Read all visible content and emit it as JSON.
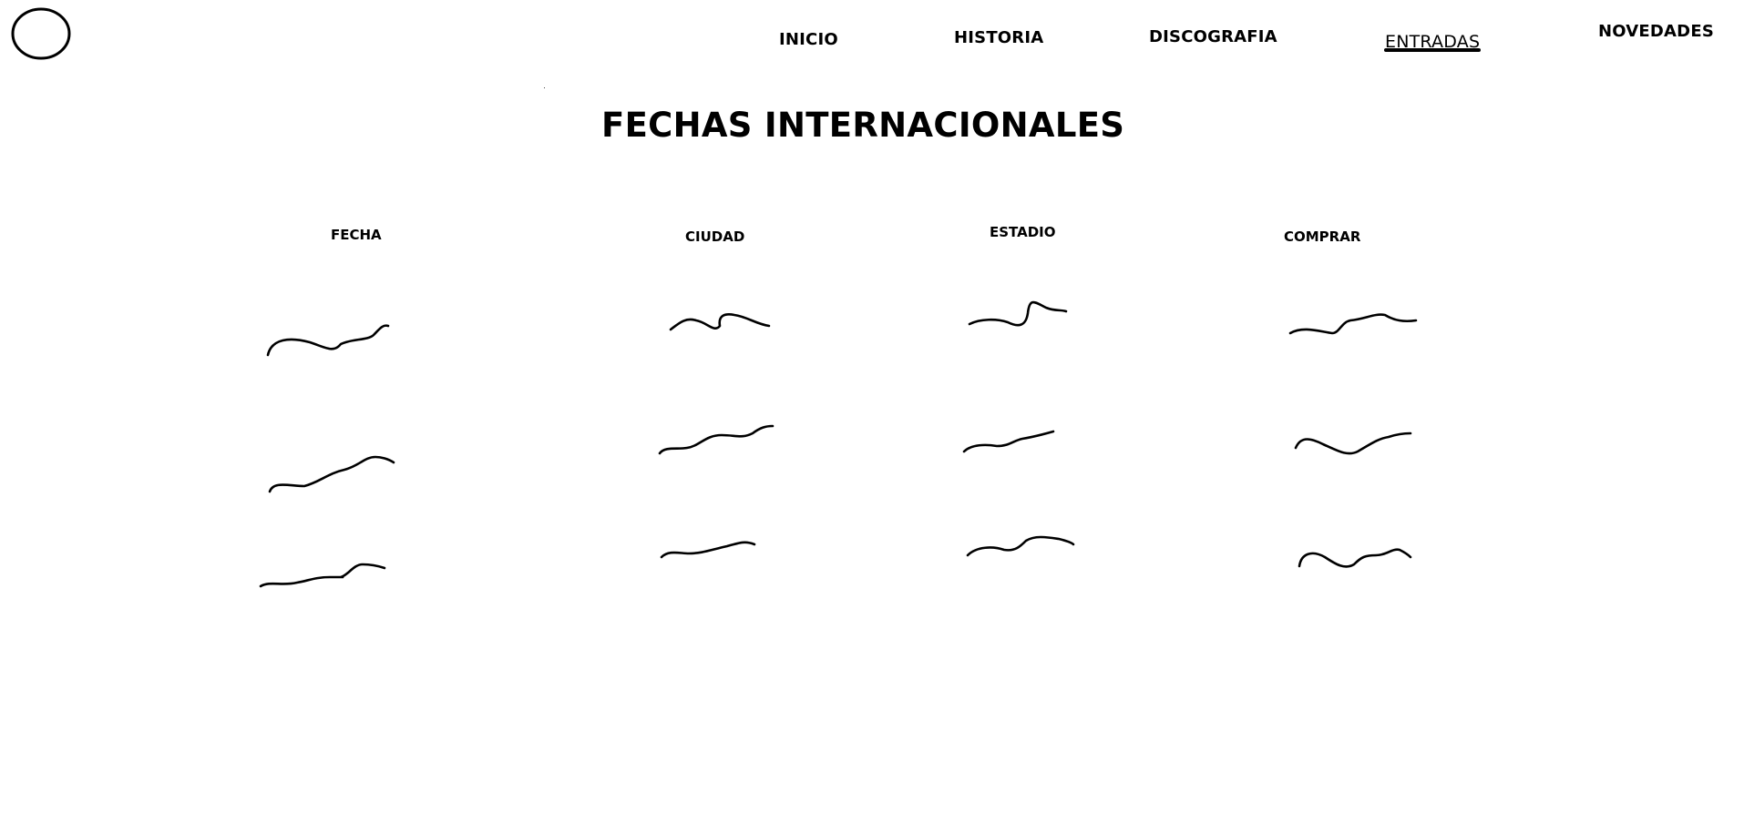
{
  "logo": {
    "icon": "circle-logo-icon"
  },
  "nav": {
    "items": [
      {
        "label": "INICIO",
        "active": false
      },
      {
        "label": "HISTORIA",
        "active": false
      },
      {
        "label": "DISCOGRAFIA",
        "active": false
      },
      {
        "label": "ENTRADAS",
        "active": true
      },
      {
        "label": "NOVEDADES",
        "active": false
      }
    ]
  },
  "page": {
    "title": "FECHAS INTERNACIONALES"
  },
  "table": {
    "columns": [
      "FECHA",
      "CIUDAD",
      "ESTADIO",
      "COMPRAR"
    ],
    "rows": 3,
    "cell_content": "scribble-placeholder"
  }
}
